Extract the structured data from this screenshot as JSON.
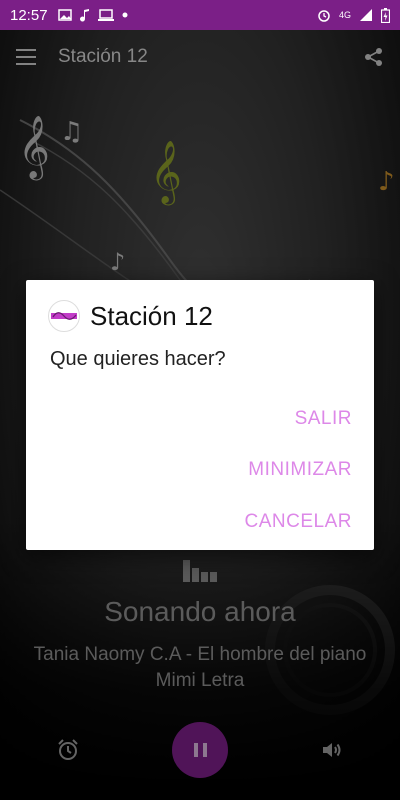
{
  "status_bar": {
    "time": "12:57",
    "network": "4G",
    "accent": "#7b1f87"
  },
  "toolbar": {
    "title": "Stación 12",
    "menu_icon": "menu-icon",
    "share_icon": "share-icon"
  },
  "now_playing": {
    "label": "Sonando ahora",
    "track": "Tania Naomy C.A - El hombre del piano Mimi Letra"
  },
  "controls": {
    "alarm_icon": "alarm-icon",
    "pause_icon": "pause-icon",
    "volume_icon": "volume-icon"
  },
  "dialog": {
    "title": "Stación 12",
    "message": "Que quieres hacer?",
    "buttons": {
      "exit": "SALIR",
      "minimize": "MINIMIZAR",
      "cancel": "CANCELAR"
    },
    "button_color": "#dd88e8"
  }
}
